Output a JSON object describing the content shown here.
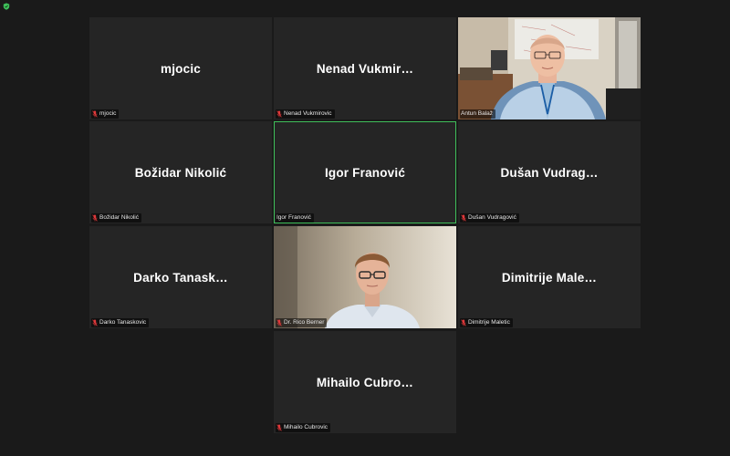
{
  "meeting": {
    "security_icon": "shield-check-icon",
    "accent_color": "#3fbf5a",
    "muted_color": "#e0383a"
  },
  "participants": [
    {
      "display": "mjocic",
      "label": "mjocic",
      "video": false,
      "muted": true
    },
    {
      "display": "Nenad Vukmir…",
      "label": "Nenad Vukmirovic",
      "video": false,
      "muted": true
    },
    {
      "display": "",
      "label": "Antun Balaž",
      "video": true,
      "muted": false
    },
    {
      "display": "Božidar Nikolić",
      "label": "Božidar Nikolić",
      "video": false,
      "muted": true
    },
    {
      "display": "Igor Franović",
      "label": "Igor Franović",
      "video": false,
      "muted": false,
      "active_speaker": true
    },
    {
      "display": "Dušan Vudrag…",
      "label": "Dušan Vudragović",
      "video": false,
      "muted": true
    },
    {
      "display": "Darko Tanask…",
      "label": "Darko Tanaskovic",
      "video": false,
      "muted": true
    },
    {
      "display": "",
      "label": "Dr. Rico Berner",
      "video": true,
      "muted": true
    },
    {
      "display": "Dimitrije Male…",
      "label": "Dimitrije Maletic",
      "video": false,
      "muted": true
    },
    {
      "display": "Mihailo Cubro…",
      "label": "Mihailo Cubrovic",
      "video": false,
      "muted": true
    }
  ]
}
